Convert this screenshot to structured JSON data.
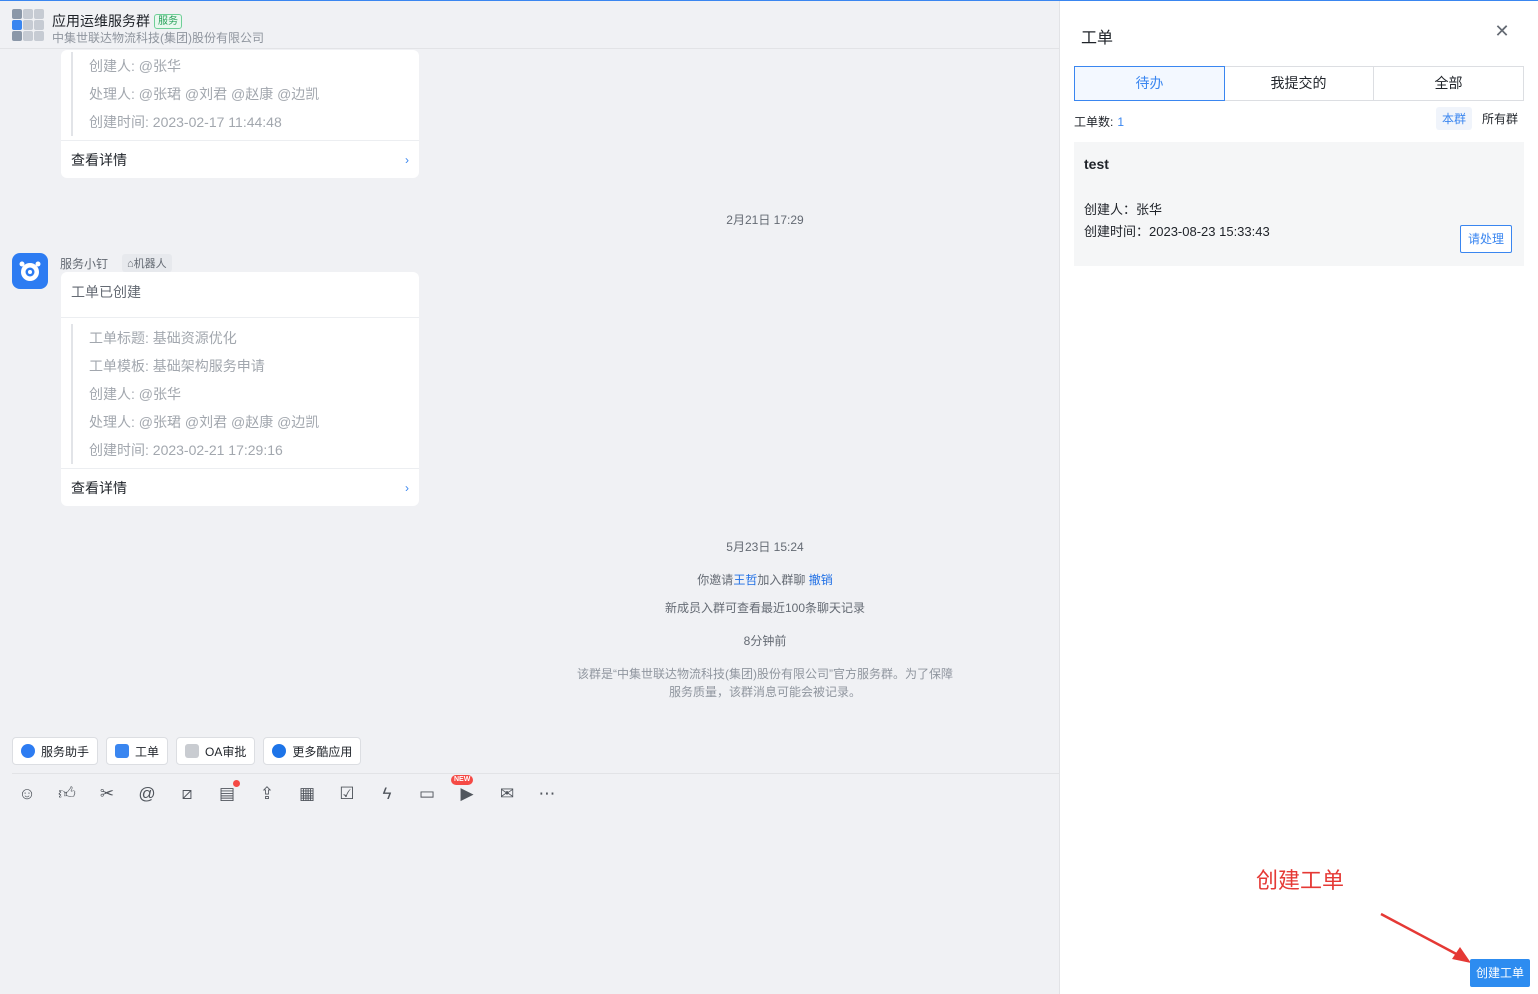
{
  "header": {
    "group_name": "应用运维服务群",
    "group_tag": "服务",
    "company": "中集世联达物流科技(集团)股份有限公司"
  },
  "card_top": {
    "lines": [
      "创建人: @张华",
      "处理人: @张珺 @刘君 @赵康 @边凯",
      "创建时间: 2023-02-17 11:44:48"
    ],
    "footer": "查看详情"
  },
  "time1": "2月21日 17:29",
  "bot": {
    "name": "服务小钉",
    "tag": "机器人"
  },
  "card_main": {
    "title": "工单已创建",
    "lines": [
      "工单标题: 基础资源优化",
      "工单模板: 基础架构服务申请",
      "创建人: @张华",
      "处理人: @张珺 @刘君 @赵康 @边凯",
      "创建时间: 2023-02-21 17:29:16"
    ],
    "footer": "查看详情"
  },
  "time2": "5月23日 15:24",
  "invite": {
    "prefix": "你邀请",
    "name": "王哲",
    "suffix": "加入群聊",
    "undo": "撤销"
  },
  "history_note": "新成员入群可查看最近100条聊天记录",
  "time3": "8分钟前",
  "notice_line1": "该群是“中集世联达物流科技(集团)股份有限公司”官方服务群。为了保障",
  "notice_line2": "服务质量，该群消息可能会被记录。",
  "quick_actions": [
    "服务助手",
    "工单",
    "OA审批",
    "更多酷应用"
  ],
  "toolbar": {
    "icons": [
      "emoji-icon",
      "thumbs-up-icon",
      "scissors-icon",
      "at-icon",
      "slash-icon",
      "note-icon",
      "upload-icon",
      "calendar-icon",
      "checkbox-icon",
      "lightning-icon",
      "video-icon",
      "live-icon",
      "mail-icon",
      "more-icon"
    ],
    "new_badge": "NEW"
  },
  "panel": {
    "title": "工单",
    "tabs": [
      "待办",
      "我提交的",
      "全部"
    ],
    "count_label": "工单数:",
    "count_value": "1",
    "scope": [
      "本群",
      "所有群"
    ],
    "ticket": {
      "title": "test",
      "creator": "创建人：张华",
      "created_at": "创建时间：2023-08-23 15:33:43",
      "action": "请处理"
    },
    "annotation": "创建工单",
    "create_button": "创建工单"
  },
  "colors": {
    "accent": "#3a86f0",
    "annotation": "#e53935",
    "badge": "#f54a45"
  }
}
